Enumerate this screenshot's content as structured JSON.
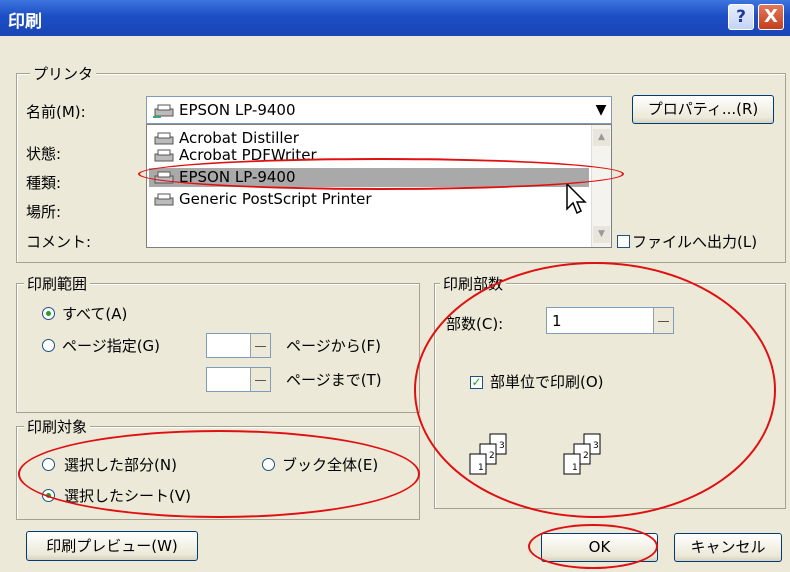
{
  "window": {
    "title": "印刷",
    "help": "?",
    "close": "X"
  },
  "printer": {
    "legend": "プリンタ",
    "name_label": "名前(M):",
    "selected": "EPSON LP-9400",
    "properties_btn": "プロパティ...(R)",
    "status_label": "状態:",
    "type_label": "種類:",
    "location_label": "場所:",
    "comment_label": "コメント:",
    "options": [
      "Acrobat Distiller",
      "Acrobat PDFWriter",
      "EPSON LP-9400",
      "Generic PostScript Printer"
    ],
    "print_to_file": "ファイルへ出力(L)"
  },
  "range": {
    "legend": "印刷範囲",
    "all": "すべて(A)",
    "pages": "ページ指定(G)",
    "from": "ページから(F)",
    "to": "ページまで(T)"
  },
  "copies": {
    "legend": "印刷部数",
    "count_label": "部数(C):",
    "count_value": "1",
    "collate": "部単位で印刷(O)"
  },
  "target": {
    "legend": "印刷対象",
    "selection": "選択した部分(N)",
    "book": "ブック全体(E)",
    "sheets": "選択したシート(V)"
  },
  "buttons": {
    "preview": "印刷プレビュー(W)",
    "ok": "OK",
    "cancel": "キャンセル"
  },
  "colors": {
    "title_bar": "#1c4ec4",
    "annotation": "#e01010",
    "selection": "#a9a9a9"
  }
}
